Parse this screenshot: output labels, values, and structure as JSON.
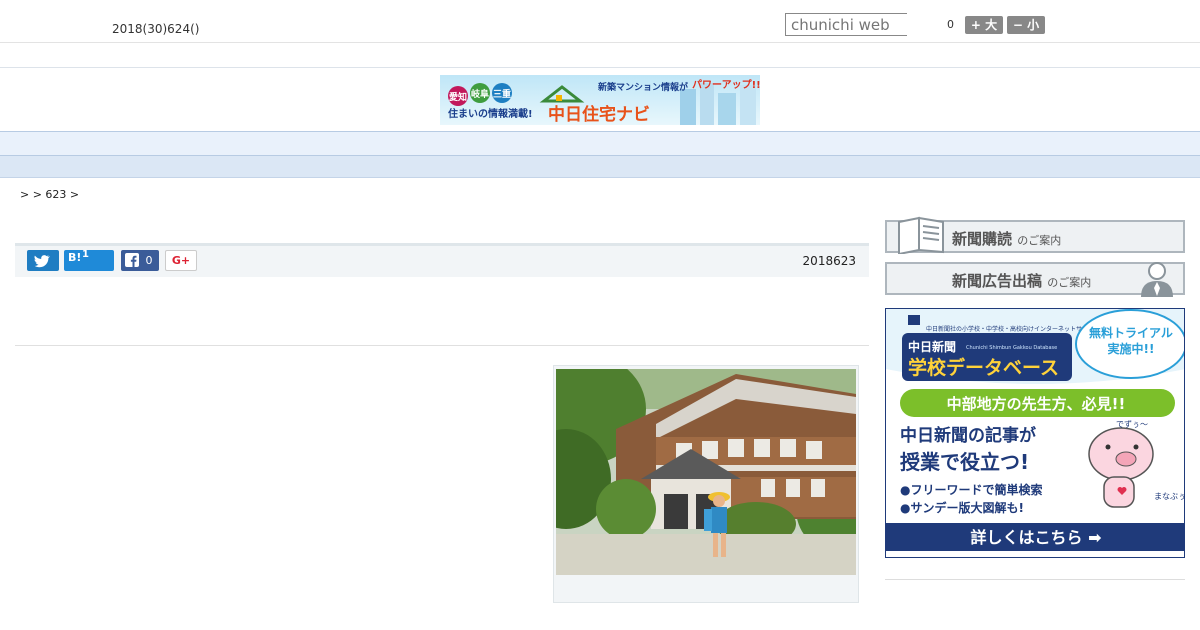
{
  "header": {
    "date": "2018(30)624()",
    "search_placeholder": "chunichi web",
    "count": "0",
    "font_large": "+ 大",
    "font_small": "− 小"
  },
  "banner": {
    "tags": [
      "愛知",
      "岐阜",
      "三重"
    ],
    "tagline": "住まいの情報満載!",
    "top_text": "新築マンション情報が",
    "power_up": "パワーアップ!!",
    "brand": "中日住宅ナビ"
  },
  "nav": {
    "items": [
      "　　",
      "　　",
      "　　",
      "　　",
      "　　",
      "　　",
      "　　",
      "　　",
      "　　"
    ]
  },
  "breadcrumb": ">  > 623 >",
  "share": {
    "hatena_label": "B!",
    "hatena_count": "1",
    "facebook_count": "0",
    "gplus_label": "G+",
    "pubdate": "2018623"
  },
  "sidebar": {
    "subscribe_main": "新聞購読",
    "subscribe_sub": "のご案内",
    "advert_main": "新聞広告出稿",
    "advert_sub": "のご案内",
    "ad": {
      "small_caption": "中日新聞社の小学校・中学校・高校向けインターネットサービス",
      "logo_line1": "中日新聞",
      "logo_line2": "学校データベース",
      "logo_en": "Chunichi Shimbun Gakkou Database",
      "trial": "無料トライアル実施中!!",
      "teachers": "中部地方の先生方、必見!!",
      "headline1": "中日新聞の記事が",
      "headline2": "授業で役立つ!",
      "bullet1": "●フリーワードで簡単検索",
      "bullet2": "●サンデー版大図解も!",
      "mascot_say": "でずぅ〜",
      "mascot_name": "まなぶぅ",
      "cta": "詳しくはこちら ➡"
    }
  },
  "colors": {
    "nav_bg": "#e9f1fb",
    "twitter": "#1f7dc2",
    "hatena": "#1f8ad8",
    "facebook": "#3b5c99",
    "ad_navy": "#1f3a7a"
  }
}
